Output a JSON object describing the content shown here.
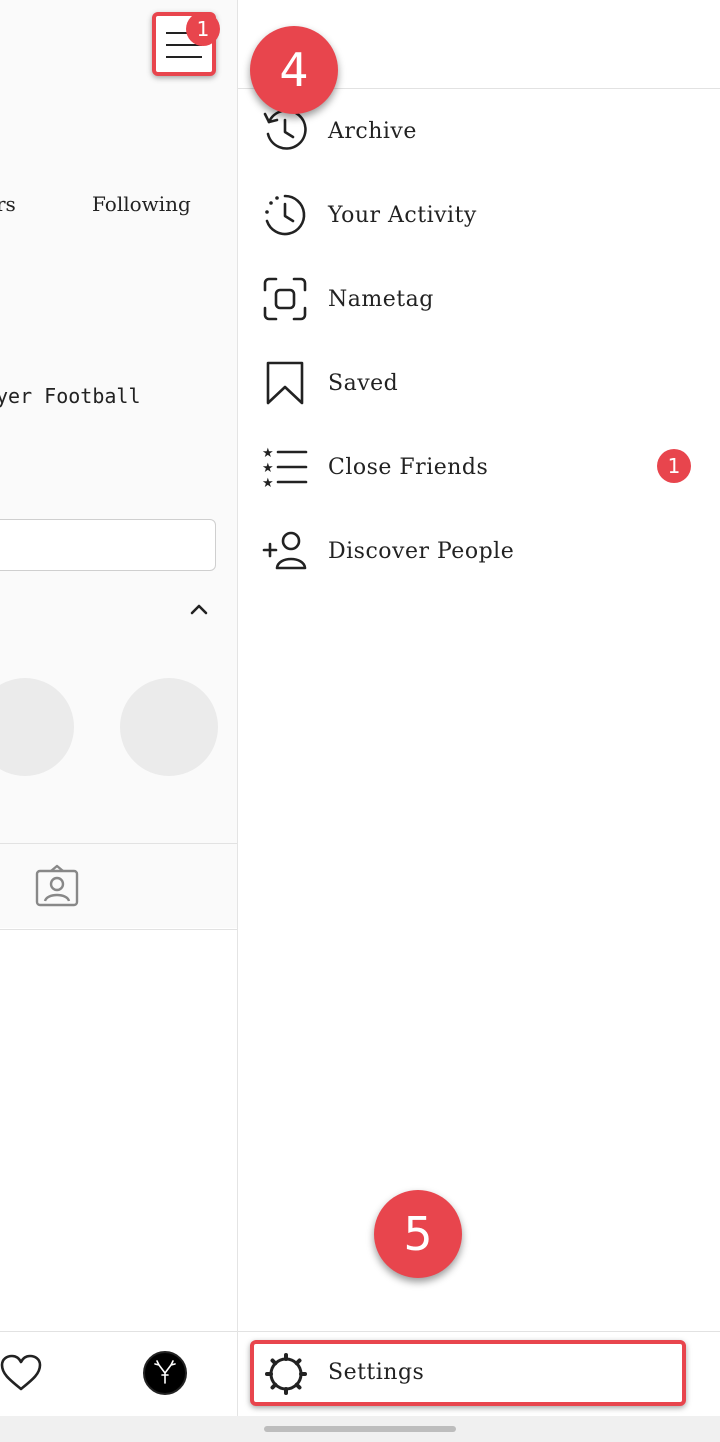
{
  "profile": {
    "followers_label": "rs",
    "following_label": "Following",
    "bio_text": "yer Football"
  },
  "header": {
    "menu_badge": "1"
  },
  "drawer": {
    "items": [
      {
        "label": "Archive",
        "icon": "archive-history-icon"
      },
      {
        "label": "Your Activity",
        "icon": "activity-clock-icon"
      },
      {
        "label": "Nametag",
        "icon": "nametag-scan-icon"
      },
      {
        "label": "Saved",
        "icon": "bookmark-icon"
      },
      {
        "label": "Close Friends",
        "icon": "close-friends-list-icon",
        "badge": "1"
      },
      {
        "label": "Discover People",
        "icon": "add-person-icon"
      }
    ],
    "settings_label": "Settings"
  },
  "callouts": {
    "step4": "4",
    "step5": "5"
  },
  "colors": {
    "accent_red": "#e8454d",
    "text": "#222222",
    "panel_bg": "#fafafa"
  }
}
